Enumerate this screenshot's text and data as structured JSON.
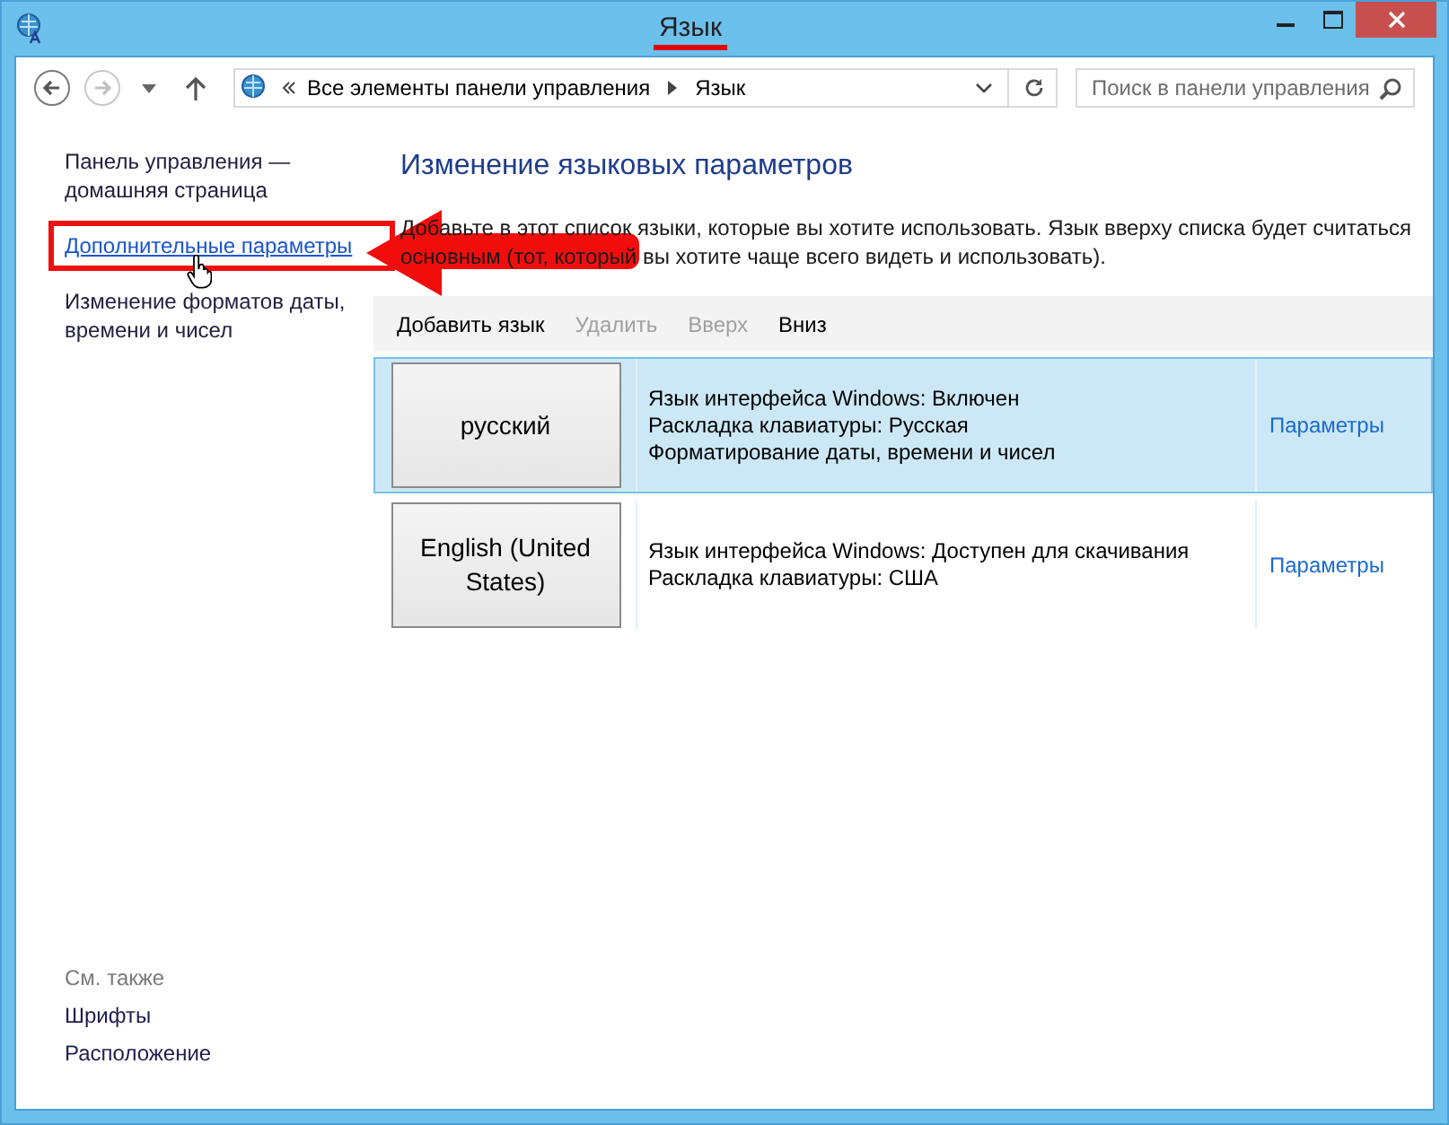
{
  "window": {
    "title": "Язык",
    "title_underlined": true
  },
  "navigation": {
    "breadcrumbs": [
      "Все элементы панели управления",
      "Язык"
    ],
    "search": {
      "placeholder": "Поиск в панели управления"
    }
  },
  "sidebar": {
    "items": [
      {
        "kind": "text",
        "label": "Панель управления — домашняя страница",
        "boxed": false,
        "cursor": false
      },
      {
        "kind": "link",
        "label": "Дополнительные параметры",
        "boxed": true,
        "cursor": true
      },
      {
        "kind": "text",
        "label": "Изменение форматов даты, времени и чисел",
        "boxed": false,
        "cursor": false
      }
    ],
    "see_also": {
      "title": "См. также",
      "links": [
        "Шрифты",
        "Расположение"
      ]
    }
  },
  "annotation_arrow": true,
  "main": {
    "heading": "Изменение языковых параметров",
    "description": "Добавьте в этот список языки, которые вы хотите использовать. Язык вверху списка будет считаться основным (тот, который вы хотите чаще всего видеть и использовать).",
    "toolbar": [
      {
        "label": "Добавить язык",
        "disabled": false
      },
      {
        "label": "Удалить",
        "disabled": true
      },
      {
        "label": "Вверх",
        "disabled": true
      },
      {
        "label": "Вниз",
        "disabled": false
      }
    ],
    "languages": [
      {
        "name": "русский",
        "selected": true,
        "details": [
          "Язык интерфейса Windows: Включен",
          "Раскладка клавиатуры: Русская",
          "Форматирование даты, времени и чисел"
        ],
        "options": "Параметры"
      },
      {
        "name": "English (United States)",
        "selected": false,
        "details": [
          "Язык интерфейса Windows: Доступен для скачивания",
          "Раскладка клавиатуры: США"
        ],
        "options": "Параметры"
      }
    ]
  }
}
